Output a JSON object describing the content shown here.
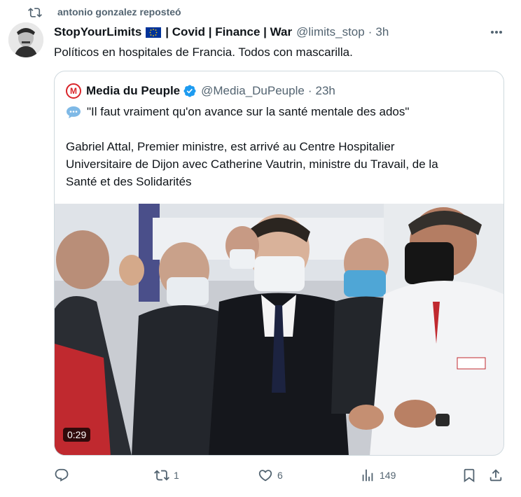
{
  "repost": {
    "icon": "repost-icon",
    "label": "antonio gonzalez reposteó"
  },
  "tweet": {
    "author": {
      "display_name": "StopYourLimits",
      "flag": "eu-flag-icon",
      "name_suffix": "| Covid | Finance | War",
      "handle": "@limits_stop",
      "separator": "·",
      "time": "3h"
    },
    "text": "Políticos en hospitales de Francia. Todos con mascarilla.",
    "quoted": {
      "logo_letter": "M",
      "display_name": "Media du Peuple",
      "handle": "@Media_DuPeuple",
      "separator": "·",
      "time": "23h",
      "quote_line": "\"Il faut vraiment qu'on avance sur la santé mentale des ados\"",
      "paragraph": "Gabriel Attal, Premier ministre, est arrivé au Centre Hospitalier\nUniversitaire de Dijon avec Catherine Vautrin, ministre du Travail, de la\nSanté et des Solidarités",
      "video_duration": "0:29"
    },
    "actions": {
      "reply": {
        "icon": "reply-icon",
        "count": ""
      },
      "repost": {
        "icon": "repost-icon",
        "count": "1"
      },
      "like": {
        "icon": "heart-icon",
        "count": "6"
      },
      "views": {
        "icon": "views-chart-icon",
        "count": "149"
      },
      "bookmark": {
        "icon": "bookmark-icon"
      },
      "share": {
        "icon": "share-icon"
      }
    }
  },
  "colors": {
    "text_primary": "#0f1419",
    "text_secondary": "#536471",
    "border": "#cfd9de",
    "verified_blue": "#1d9bf0",
    "brand_red": "#d9252a"
  }
}
